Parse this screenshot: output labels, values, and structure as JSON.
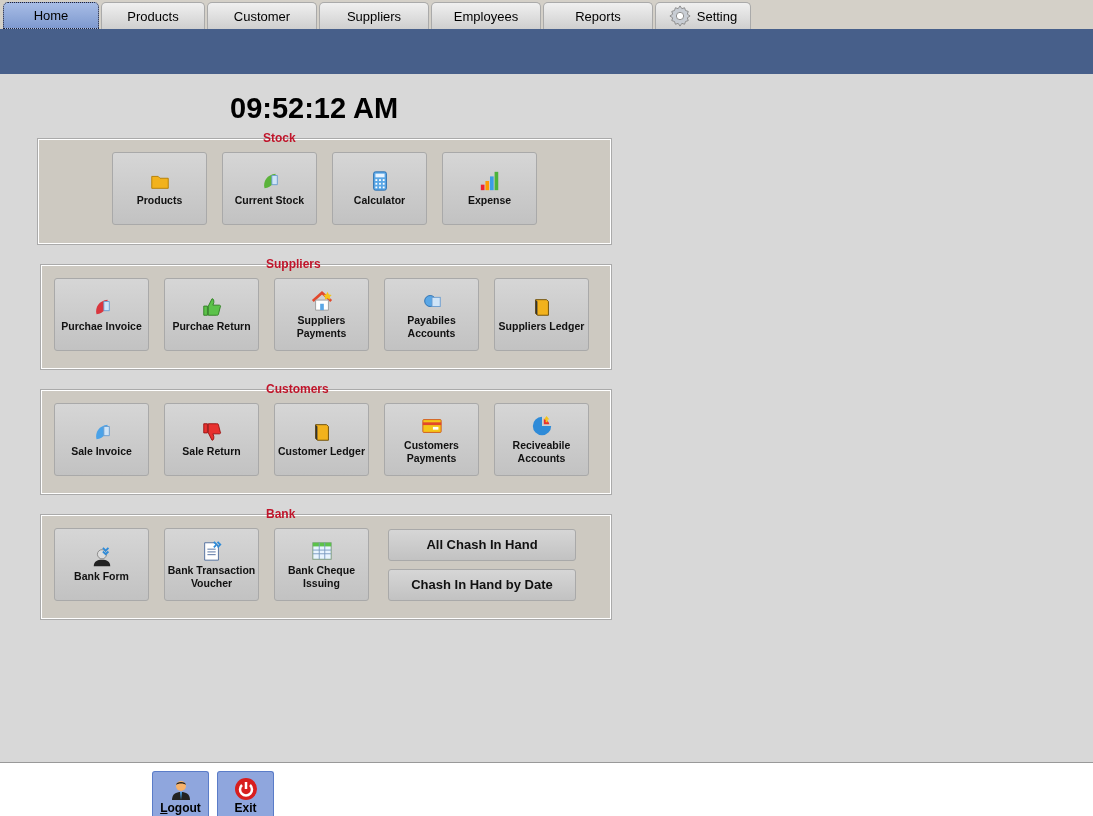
{
  "tabs": [
    {
      "label": "Home",
      "selected": true
    },
    {
      "label": "Products",
      "selected": false
    },
    {
      "label": "Customer",
      "selected": false
    },
    {
      "label": "Suppliers",
      "selected": false
    },
    {
      "label": "Employees",
      "selected": false
    },
    {
      "label": "Reports",
      "selected": false
    },
    {
      "label": "Setting",
      "selected": false
    }
  ],
  "clock": "09:52:12 AM",
  "sections": [
    {
      "title": "Stock",
      "buttons": [
        {
          "kind": "icon",
          "label": "Products"
        },
        {
          "kind": "icon",
          "label": "Current Stock"
        },
        {
          "kind": "icon",
          "label": "Calculator"
        },
        {
          "kind": "icon",
          "label": "Expense"
        }
      ]
    },
    {
      "title": "Suppliers",
      "buttons": [
        {
          "kind": "icon",
          "label": "Purchae Invoice"
        },
        {
          "kind": "icon",
          "label": "Purchae Return"
        },
        {
          "kind": "icon",
          "label": "Suppliers Payments"
        },
        {
          "kind": "icon",
          "label": "Payabiles Accounts"
        },
        {
          "kind": "icon",
          "label": "Suppliers Ledger"
        }
      ]
    },
    {
      "title": "Customers",
      "buttons": [
        {
          "kind": "icon",
          "label": "Sale Invoice"
        },
        {
          "kind": "icon",
          "label": "Sale Return"
        },
        {
          "kind": "icon",
          "label": "Customer Ledger"
        },
        {
          "kind": "icon",
          "label": "Customers Payments"
        },
        {
          "kind": "icon",
          "label": "Reciveabile Accounts"
        }
      ]
    },
    {
      "title": "Bank",
      "buttons": [
        {
          "kind": "icon",
          "label": "Bank Form"
        },
        {
          "kind": "icon",
          "label": "Bank Transaction Voucher"
        },
        {
          "kind": "icon",
          "label": "Bank Cheque Issuing"
        },
        {
          "kind": "wide",
          "labels": [
            "All Chash In Hand",
            "Chash In Hand by Date"
          ]
        }
      ]
    }
  ],
  "footer": [
    {
      "label": "Logout"
    },
    {
      "label": "Exit"
    }
  ]
}
